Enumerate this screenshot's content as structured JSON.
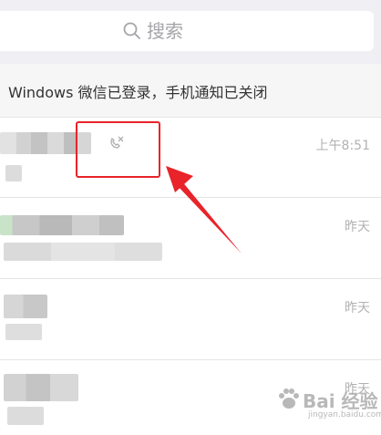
{
  "search": {
    "placeholder": "搜索",
    "icon": "search-icon"
  },
  "notice": {
    "text": "Windows 微信已登录，手机通知已关闭"
  },
  "chats": [
    {
      "time": "上午8:51",
      "mute_icon": "phone-muted-icon"
    },
    {
      "time": "昨天"
    },
    {
      "time": "昨天"
    },
    {
      "time": "昨天"
    }
  ],
  "watermark": {
    "brand": "Bai 经验",
    "url": "jingyan.baidu.com"
  },
  "colors": {
    "highlight": "#e8232a",
    "search_bg": "#efeff4",
    "notice_bg": "#f6f6f6",
    "time_text": "#b2b2b2"
  }
}
